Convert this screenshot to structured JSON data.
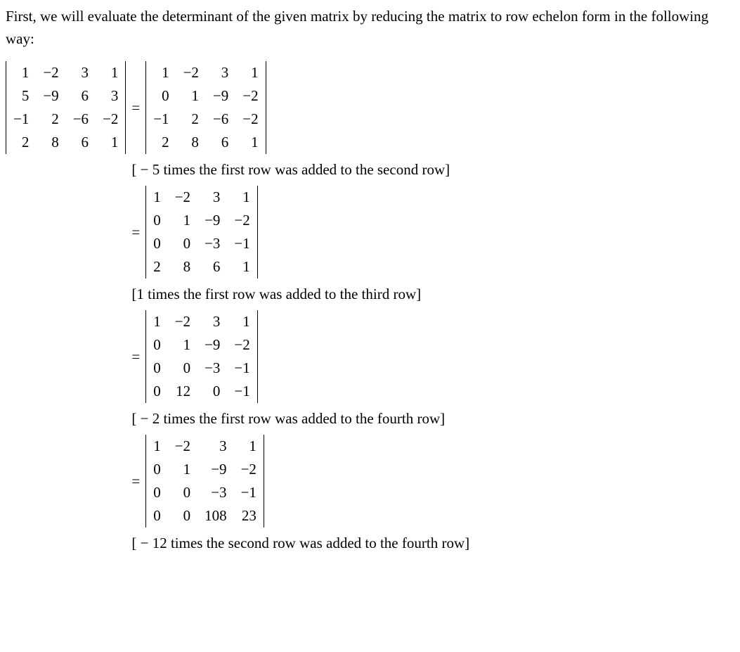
{
  "intro": "First, we will evaluate the determinant of the given matrix by reducing the matrix to row echelon form in the following way:",
  "lhs_matrix": [
    [
      "1",
      "−2",
      "3",
      "1"
    ],
    [
      "5",
      "−9",
      "6",
      "3"
    ],
    [
      "−1",
      "2",
      "−6",
      "−2"
    ],
    [
      "2",
      "8",
      "6",
      "1"
    ]
  ],
  "steps": [
    {
      "matrix": [
        [
          "1",
          "−2",
          "3",
          "1"
        ],
        [
          "0",
          "1",
          "−9",
          "−2"
        ],
        [
          "−1",
          "2",
          "−6",
          "−2"
        ],
        [
          "2",
          "8",
          "6",
          "1"
        ]
      ],
      "explain": "[ − 5 times the first row was added to the second row]"
    },
    {
      "matrix": [
        [
          "1",
          "−2",
          "3",
          "1"
        ],
        [
          "0",
          "1",
          "−9",
          "−2"
        ],
        [
          "0",
          "0",
          "−3",
          "−1"
        ],
        [
          "2",
          "8",
          "6",
          "1"
        ]
      ],
      "explain": "[1 times the first row was added to the third row]"
    },
    {
      "matrix": [
        [
          "1",
          "−2",
          "3",
          "1"
        ],
        [
          "0",
          "1",
          "−9",
          "−2"
        ],
        [
          "0",
          "0",
          "−3",
          "−1"
        ],
        [
          "0",
          "12",
          "0",
          "−1"
        ]
      ],
      "explain": "[ − 2 times the first row was added to the fourth row]"
    },
    {
      "matrix": [
        [
          "1",
          "−2",
          "3",
          "1"
        ],
        [
          "0",
          "1",
          "−9",
          "−2"
        ],
        [
          "0",
          "0",
          "−3",
          "−1"
        ],
        [
          "0",
          "0",
          "108",
          "23"
        ]
      ],
      "explain": "[ − 12 times the second row was added to the fourth row]"
    }
  ],
  "equals": "="
}
